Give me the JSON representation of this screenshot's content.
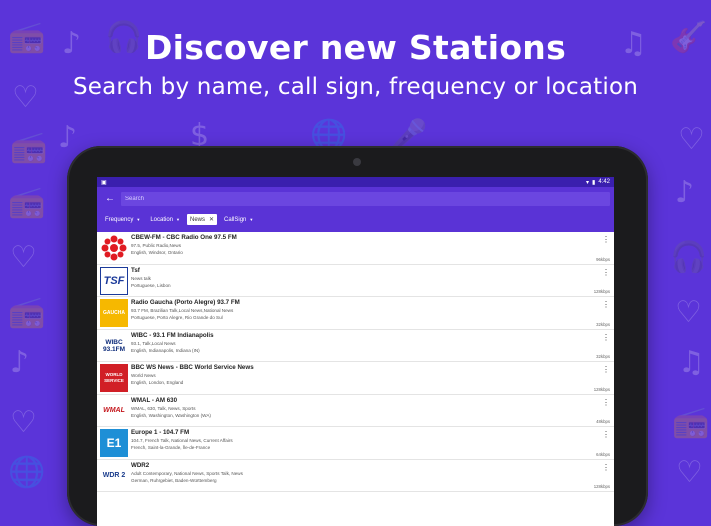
{
  "headline": "Discover new Stations",
  "subheadline": "Search by name, call sign, frequency or location",
  "status_bar": {
    "time": "4:42"
  },
  "search": {
    "placeholder": "Search"
  },
  "filters": [
    {
      "label": "Frequency",
      "active": false
    },
    {
      "label": "Location",
      "active": false
    },
    {
      "label": "News",
      "active": true
    },
    {
      "label": "CallSign",
      "active": false
    }
  ],
  "stations": [
    {
      "name": "CBEW-FM - CBC Radio One 97.5 FM",
      "genre": "97.5, Public Radio,News",
      "location": "English, Windsor, Ontario",
      "bitrate": "96kbps",
      "logo_text": "",
      "logo_icon": "cbc-logo"
    },
    {
      "name": "Tsf",
      "genre": "News talk",
      "location": "Portuguese, Lisbon",
      "bitrate": "128kbps",
      "logo_text": "TSF",
      "logo_icon": "tsf-logo"
    },
    {
      "name": "Radio Gaucha (Porto Alegre) 93.7 FM",
      "genre": "93.7 FM, Brazilian Talk,Local News,National News",
      "location": "Portuguese, Porto Alegre, Rio Grande do Sul",
      "bitrate": "32kbps",
      "logo_text": "GAUCHA",
      "logo_icon": "gaucha-logo"
    },
    {
      "name": "WIBC - 93.1 FM Indianapolis",
      "genre": "93.1, Talk,Local News",
      "location": "English, Indianapolis, Indiana (IN)",
      "bitrate": "32kbps",
      "logo_text": "WIBC 93.1FM",
      "logo_icon": "wibc-logo"
    },
    {
      "name": "BBC WS News - BBC World Service News",
      "genre": "World News",
      "location": "English, London, England",
      "bitrate": "128kbps",
      "logo_text": "WORLD SERVICE",
      "logo_icon": "bbc-logo"
    },
    {
      "name": "WMAL - AM 630",
      "genre": "WMAL, 630, Talk, News, Sports",
      "location": "English, Washington, Washington (WA)",
      "bitrate": "48kbps",
      "logo_text": "WMAL",
      "logo_icon": "wmal-logo"
    },
    {
      "name": "Europe 1 - 104.7 FM",
      "genre": "104.7, French Talk, National News, Current Affairs",
      "location": "French, Saint-la-Grande, Île-de-France",
      "bitrate": "64kbps",
      "logo_text": "E1",
      "logo_icon": "europe1-logo"
    },
    {
      "name": "WDR2",
      "genre": "Adult Contemporary, National News, Sports Talk, News",
      "location": "German, Ruhrgebiet, Baden-Württemberg",
      "bitrate": "128kbps",
      "logo_text": "WDR 2",
      "logo_icon": "wdr2-logo"
    }
  ],
  "colors": {
    "background": "#5b34d9",
    "app_bar": "#5a33d6",
    "status_bar": "#3a1fae"
  }
}
